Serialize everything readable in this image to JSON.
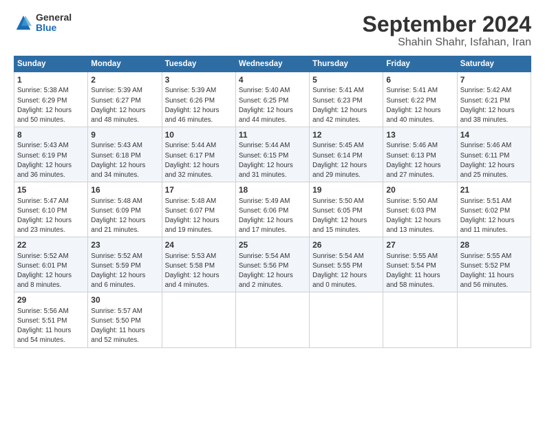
{
  "logo": {
    "general": "General",
    "blue": "Blue"
  },
  "title": "September 2024",
  "subtitle": "Shahin Shahr, Isfahan, Iran",
  "headers": [
    "Sunday",
    "Monday",
    "Tuesday",
    "Wednesday",
    "Thursday",
    "Friday",
    "Saturday"
  ],
  "weeks": [
    [
      {
        "day": "1",
        "info": "Sunrise: 5:38 AM\nSunset: 6:29 PM\nDaylight: 12 hours\nand 50 minutes."
      },
      {
        "day": "2",
        "info": "Sunrise: 5:39 AM\nSunset: 6:27 PM\nDaylight: 12 hours\nand 48 minutes."
      },
      {
        "day": "3",
        "info": "Sunrise: 5:39 AM\nSunset: 6:26 PM\nDaylight: 12 hours\nand 46 minutes."
      },
      {
        "day": "4",
        "info": "Sunrise: 5:40 AM\nSunset: 6:25 PM\nDaylight: 12 hours\nand 44 minutes."
      },
      {
        "day": "5",
        "info": "Sunrise: 5:41 AM\nSunset: 6:23 PM\nDaylight: 12 hours\nand 42 minutes."
      },
      {
        "day": "6",
        "info": "Sunrise: 5:41 AM\nSunset: 6:22 PM\nDaylight: 12 hours\nand 40 minutes."
      },
      {
        "day": "7",
        "info": "Sunrise: 5:42 AM\nSunset: 6:21 PM\nDaylight: 12 hours\nand 38 minutes."
      }
    ],
    [
      {
        "day": "8",
        "info": "Sunrise: 5:43 AM\nSunset: 6:19 PM\nDaylight: 12 hours\nand 36 minutes."
      },
      {
        "day": "9",
        "info": "Sunrise: 5:43 AM\nSunset: 6:18 PM\nDaylight: 12 hours\nand 34 minutes."
      },
      {
        "day": "10",
        "info": "Sunrise: 5:44 AM\nSunset: 6:17 PM\nDaylight: 12 hours\nand 32 minutes."
      },
      {
        "day": "11",
        "info": "Sunrise: 5:44 AM\nSunset: 6:15 PM\nDaylight: 12 hours\nand 31 minutes."
      },
      {
        "day": "12",
        "info": "Sunrise: 5:45 AM\nSunset: 6:14 PM\nDaylight: 12 hours\nand 29 minutes."
      },
      {
        "day": "13",
        "info": "Sunrise: 5:46 AM\nSunset: 6:13 PM\nDaylight: 12 hours\nand 27 minutes."
      },
      {
        "day": "14",
        "info": "Sunrise: 5:46 AM\nSunset: 6:11 PM\nDaylight: 12 hours\nand 25 minutes."
      }
    ],
    [
      {
        "day": "15",
        "info": "Sunrise: 5:47 AM\nSunset: 6:10 PM\nDaylight: 12 hours\nand 23 minutes."
      },
      {
        "day": "16",
        "info": "Sunrise: 5:48 AM\nSunset: 6:09 PM\nDaylight: 12 hours\nand 21 minutes."
      },
      {
        "day": "17",
        "info": "Sunrise: 5:48 AM\nSunset: 6:07 PM\nDaylight: 12 hours\nand 19 minutes."
      },
      {
        "day": "18",
        "info": "Sunrise: 5:49 AM\nSunset: 6:06 PM\nDaylight: 12 hours\nand 17 minutes."
      },
      {
        "day": "19",
        "info": "Sunrise: 5:50 AM\nSunset: 6:05 PM\nDaylight: 12 hours\nand 15 minutes."
      },
      {
        "day": "20",
        "info": "Sunrise: 5:50 AM\nSunset: 6:03 PM\nDaylight: 12 hours\nand 13 minutes."
      },
      {
        "day": "21",
        "info": "Sunrise: 5:51 AM\nSunset: 6:02 PM\nDaylight: 12 hours\nand 11 minutes."
      }
    ],
    [
      {
        "day": "22",
        "info": "Sunrise: 5:52 AM\nSunset: 6:01 PM\nDaylight: 12 hours\nand 8 minutes."
      },
      {
        "day": "23",
        "info": "Sunrise: 5:52 AM\nSunset: 5:59 PM\nDaylight: 12 hours\nand 6 minutes."
      },
      {
        "day": "24",
        "info": "Sunrise: 5:53 AM\nSunset: 5:58 PM\nDaylight: 12 hours\nand 4 minutes."
      },
      {
        "day": "25",
        "info": "Sunrise: 5:54 AM\nSunset: 5:56 PM\nDaylight: 12 hours\nand 2 minutes."
      },
      {
        "day": "26",
        "info": "Sunrise: 5:54 AM\nSunset: 5:55 PM\nDaylight: 12 hours\nand 0 minutes."
      },
      {
        "day": "27",
        "info": "Sunrise: 5:55 AM\nSunset: 5:54 PM\nDaylight: 11 hours\nand 58 minutes."
      },
      {
        "day": "28",
        "info": "Sunrise: 5:55 AM\nSunset: 5:52 PM\nDaylight: 11 hours\nand 56 minutes."
      }
    ],
    [
      {
        "day": "29",
        "info": "Sunrise: 5:56 AM\nSunset: 5:51 PM\nDaylight: 11 hours\nand 54 minutes."
      },
      {
        "day": "30",
        "info": "Sunrise: 5:57 AM\nSunset: 5:50 PM\nDaylight: 11 hours\nand 52 minutes."
      },
      {
        "day": "",
        "info": ""
      },
      {
        "day": "",
        "info": ""
      },
      {
        "day": "",
        "info": ""
      },
      {
        "day": "",
        "info": ""
      },
      {
        "day": "",
        "info": ""
      }
    ]
  ]
}
